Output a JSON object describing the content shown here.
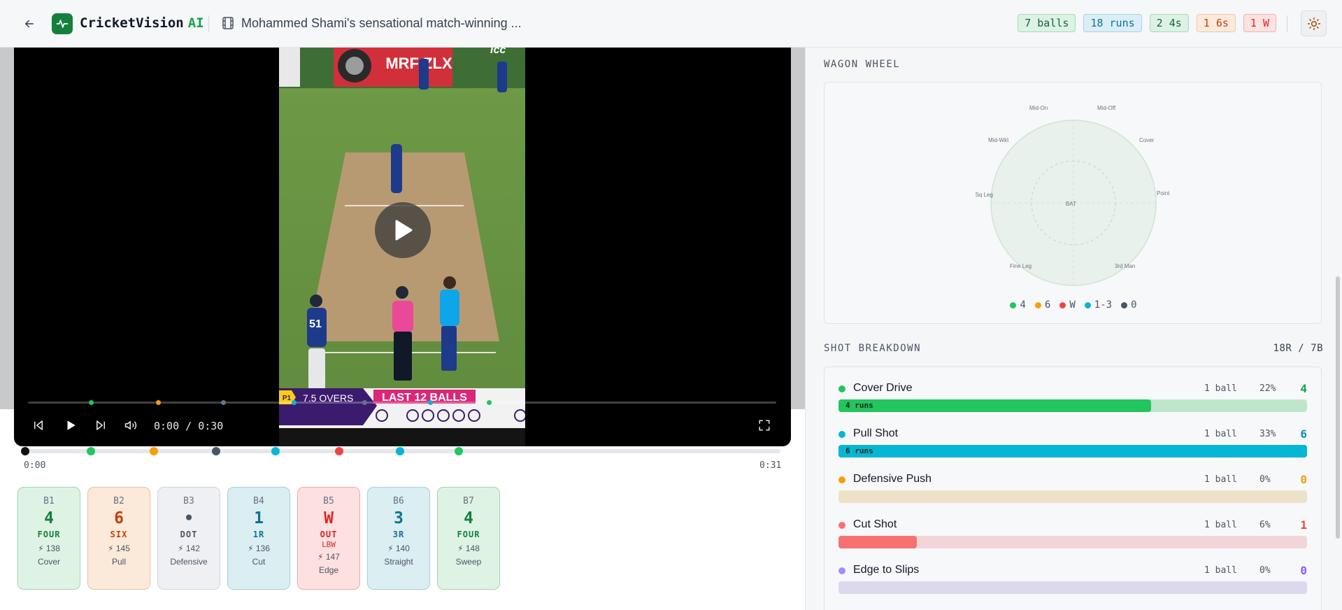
{
  "header": {
    "brand_name": "CricketVision",
    "brand_suffix": "AI",
    "video_title": "Mohammed Shami's sensational match-winning ...",
    "stats": [
      {
        "label": "7 balls",
        "tone": "g"
      },
      {
        "label": "18 runs",
        "tone": "b"
      },
      {
        "label": "2 4s",
        "tone": "g"
      },
      {
        "label": "1 6s",
        "tone": "o"
      },
      {
        "label": "1 W",
        "tone": "r"
      }
    ]
  },
  "video": {
    "scorebug_tag": "P1",
    "scorebug_overs": "7.5 OVERS",
    "scorebug_banner": "LAST 12 BALLS",
    "billboard": "MRF ZLX",
    "sponsor": "icc",
    "jersey_number": "51",
    "time_display": "0:00 / 0:30",
    "is_playing": false
  },
  "timeline": {
    "start_label": "0:00",
    "end_label": "0:31",
    "markers": [
      {
        "ball": "start",
        "color": "#111111"
      },
      {
        "ball": "B1",
        "color": "#22c55e"
      },
      {
        "ball": "B2",
        "color": "#f59e0b"
      },
      {
        "ball": "B3",
        "color": "#475569"
      },
      {
        "ball": "B4",
        "color": "#06b6d4"
      },
      {
        "ball": "B5",
        "color": "#ef4444"
      },
      {
        "ball": "B6",
        "color": "#06b6d4"
      },
      {
        "ball": "B7",
        "color": "#22c55e"
      }
    ]
  },
  "balls": [
    {
      "label": "B1",
      "value": "4",
      "type": "FOUR",
      "sub": "",
      "speed": "138",
      "shot": "Cover",
      "tone": "c-green"
    },
    {
      "label": "B2",
      "value": "6",
      "type": "SIX",
      "sub": "",
      "speed": "145",
      "shot": "Pull",
      "tone": "c-orange"
    },
    {
      "label": "B3",
      "value": "•",
      "type": "DOT",
      "sub": "",
      "speed": "142",
      "shot": "Defensive",
      "tone": "c-gray"
    },
    {
      "label": "B4",
      "value": "1",
      "type": "1R",
      "sub": "",
      "speed": "136",
      "shot": "Cut",
      "tone": "c-teal"
    },
    {
      "label": "B5",
      "value": "W",
      "type": "OUT",
      "sub": "LBW",
      "speed": "147",
      "shot": "Edge",
      "tone": "c-red"
    },
    {
      "label": "B6",
      "value": "3",
      "type": "3R",
      "sub": "",
      "speed": "140",
      "shot": "Straight",
      "tone": "c-teal"
    },
    {
      "label": "B7",
      "value": "4",
      "type": "FOUR",
      "sub": "",
      "speed": "148",
      "shot": "Sweep",
      "tone": "c-green"
    }
  ],
  "wagon_wheel": {
    "title": "WAGON WHEEL",
    "center_label": "BAT",
    "field_labels": {
      "mid_on": "Mid-On",
      "mid_off": "Mid-Off",
      "mid_wkt": "Mid-Wkt",
      "cover": "Cover",
      "sq_leg": "Sq Leg",
      "point": "Point",
      "fine_leg": "Fine Leg",
      "third_man": "3rd Man"
    },
    "legend": [
      {
        "label": "4",
        "color": "#22c55e"
      },
      {
        "label": "6",
        "color": "#f59e0b"
      },
      {
        "label": "W",
        "color": "#ef4444"
      },
      {
        "label": "1-3",
        "color": "#06b6d4"
      },
      {
        "label": "0",
        "color": "#475569"
      }
    ]
  },
  "shot_breakdown": {
    "title": "SHOT BREAKDOWN",
    "summary": "18R / 7B",
    "shots": [
      {
        "name": "Cover Drive",
        "balls": "1 ball",
        "pct": "22%",
        "runs": "4",
        "fill": 0.667,
        "fill_label": "4 runs",
        "color": "#22c55e",
        "track": "#bfe6cb",
        "runs_color": "#16a34a"
      },
      {
        "name": "Pull Shot",
        "balls": "1 ball",
        "pct": "33%",
        "runs": "6",
        "fill": 1.0,
        "fill_label": "6 runs",
        "color": "#06b6d4",
        "track": "#b8e4ee",
        "runs_color": "#0891b2"
      },
      {
        "name": "Defensive Push",
        "balls": "1 ball",
        "pct": "0%",
        "runs": "0",
        "fill": 0.0,
        "fill_label": "",
        "color": "#f59e0b",
        "track": "#ede2c7",
        "runs_color": "#f59e0b"
      },
      {
        "name": "Cut Shot",
        "balls": "1 ball",
        "pct": "6%",
        "runs": "1",
        "fill": 0.167,
        "fill_label": "",
        "color": "#f87171",
        "track": "#f1d5d8",
        "runs_color": "#ef4444"
      },
      {
        "name": "Edge to Slips",
        "balls": "1 ball",
        "pct": "0%",
        "runs": "0",
        "fill": 0.0,
        "fill_label": "",
        "color": "#a78bfa",
        "track": "#dcd8ee",
        "runs_color": "#8b5cf6"
      }
    ]
  }
}
